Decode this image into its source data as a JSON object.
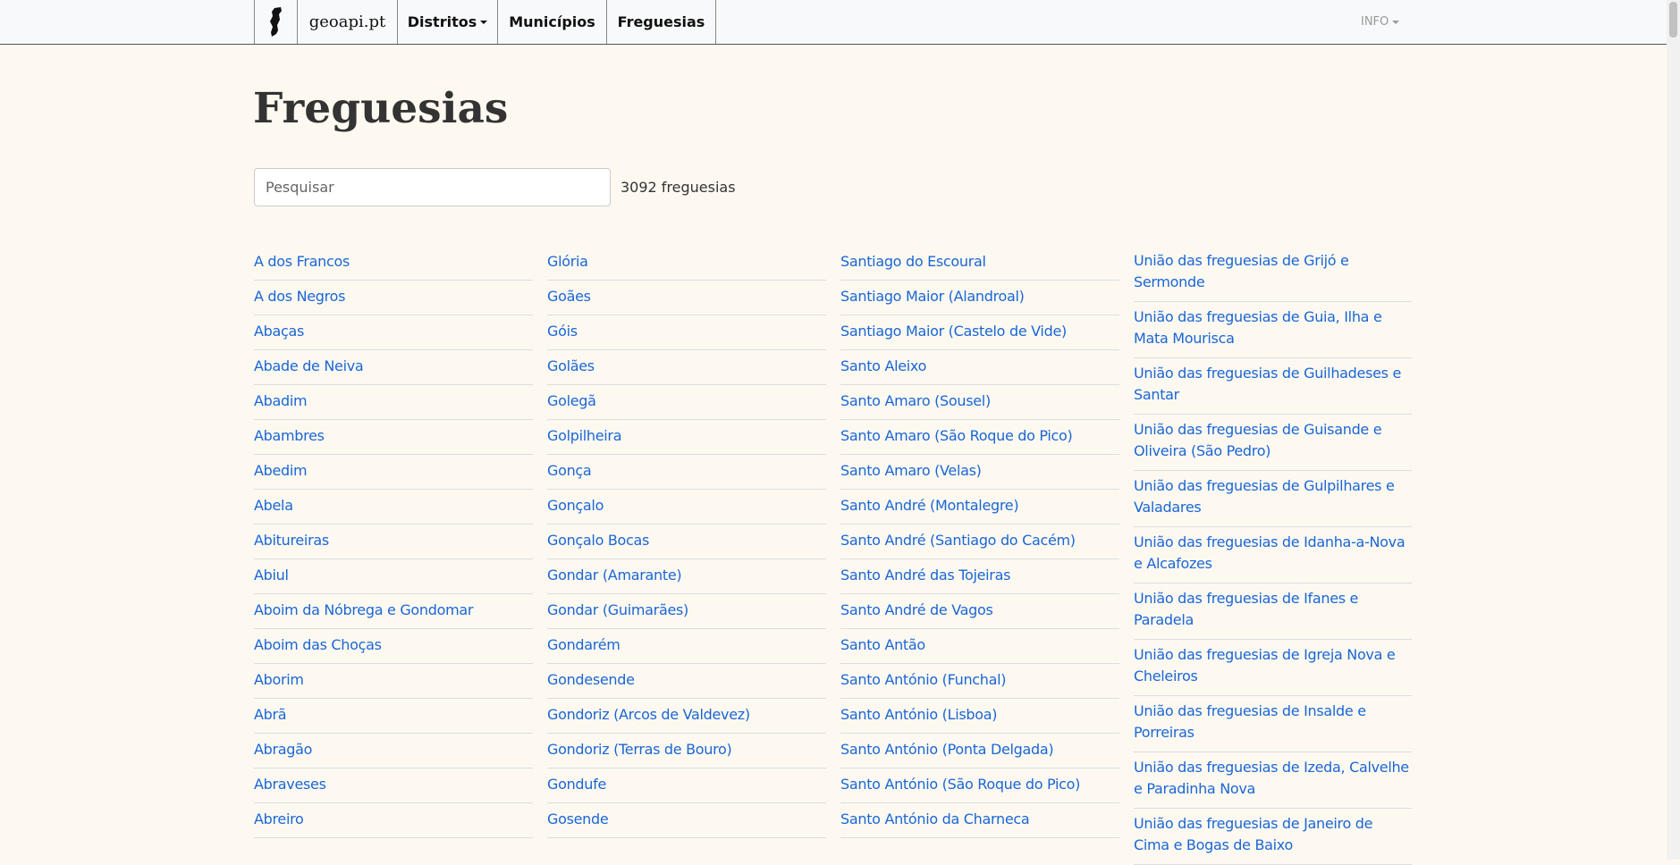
{
  "nav": {
    "brand": "geoapi.pt",
    "distritos": "Distritos",
    "municipios": "Municípios",
    "freguesias": "Freguesias",
    "info": "INFO",
    "logo_icon": "portugal-map-icon"
  },
  "page": {
    "title": "Freguesias",
    "search_placeholder": "Pesquisar",
    "count": "3092 freguesias"
  },
  "columns": [
    [
      "A dos Francos",
      "A dos Negros",
      "Abaças",
      "Abade de Neiva",
      "Abadim",
      "Abambres",
      "Abedim",
      "Abela",
      "Abitureiras",
      "Abiul",
      "Aboim da Nóbrega e Gondomar",
      "Aboim das Choças",
      "Aborim",
      "Abrã",
      "Abragão",
      "Abraveses",
      "Abreiro"
    ],
    [
      "Glória",
      "Goães",
      "Góis",
      "Golães",
      "Golegã",
      "Golpilheira",
      "Gonça",
      "Gonçalo",
      "Gonçalo Bocas",
      "Gondar (Amarante)",
      "Gondar (Guimarães)",
      "Gondarém",
      "Gondesende",
      "Gondoriz (Arcos de Valdevez)",
      "Gondoriz (Terras de Bouro)",
      "Gondufe",
      "Gosende"
    ],
    [
      "Santiago do Escoural",
      "Santiago Maior (Alandroal)",
      "Santiago Maior (Castelo de Vide)",
      "Santo Aleixo",
      "Santo Amaro (Sousel)",
      "Santo Amaro (São Roque do Pico)",
      "Santo Amaro (Velas)",
      "Santo André (Montalegre)",
      "Santo André (Santiago do Cacém)",
      "Santo André das Tojeiras",
      "Santo André de Vagos",
      "Santo Antão",
      "Santo António (Funchal)",
      "Santo António (Lisboa)",
      "Santo António (Ponta Delgada)",
      "Santo António (São Roque do Pico)",
      "Santo António da Charneca"
    ],
    [
      "União das freguesias de Grijó e Sermonde",
      "União das freguesias de Guia, Ilha e Mata Mourisca",
      "União das freguesias de Guilhadeses e Santar",
      "União das freguesias de Guisande e Oliveira (São Pedro)",
      "União das freguesias de Gulpilhares e Valadares",
      "União das freguesias de Idanha-a-Nova e Alcafozes",
      "União das freguesias de Ifanes e Paradela",
      "União das freguesias de Igreja Nova e Cheleiros",
      "União das freguesias de Insalde e Porreiras",
      "União das freguesias de Izeda, Calvelhe e Paradinha Nova",
      "União das freguesias de Janeiro de Cima e Bogas de Baixo"
    ]
  ]
}
